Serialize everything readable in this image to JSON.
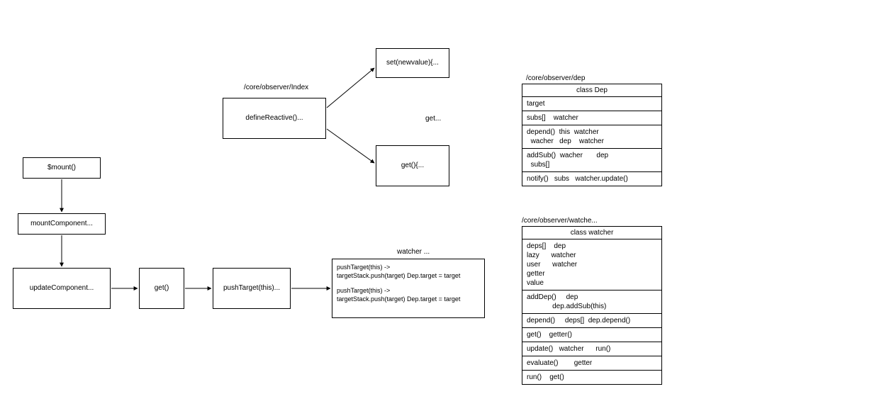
{
  "flow": {
    "mount": "$mount()",
    "mountComponent": "mountComponent...",
    "updateComponent": "updateComponent...",
    "get": "get()",
    "pushTarget": "pushTarget(this)...",
    "watcherLabel": "watcher ...",
    "pushBox_line1": "pushTarget(this) ->",
    "pushBox_line2": "targetStack.push(target)  Dep.target = target",
    "pushBox_line3": "pushTarget(this) ->",
    "pushBox_line4": "targetStack.push(target)  Dep.target = target",
    "observerIndexLabel": "/core/observer/Index",
    "defineReactive": "defineReactive()...",
    "setBox": "set(newvalue){...",
    "getBox": "get(){...",
    "getLabel": "get..."
  },
  "dep": {
    "path": "/core/observer/dep",
    "title": "class Dep",
    "target": "target",
    "subs": "subs[]    watcher",
    "depend": "depend()  this  watcher\n  wacher   dep    watcher",
    "addSub": "addSub()  wacher       dep\n  subs[]",
    "notify": "notify()   subs   watcher.update()"
  },
  "watcher": {
    "path": "/core/observer/watche...",
    "title": "class watcher",
    "props": "deps[]    dep\nlazy      watcher\nuser      watcher\ngetter\nvalue",
    "addDep": "addDep()     dep\n             dep.addSub(this)",
    "depend": "depend()     deps[]  dep.depend()",
    "get": "get()    getter()",
    "update": "update()   watcher      run()",
    "evaluate": "evaluate()        getter",
    "run": "run()    get()"
  }
}
